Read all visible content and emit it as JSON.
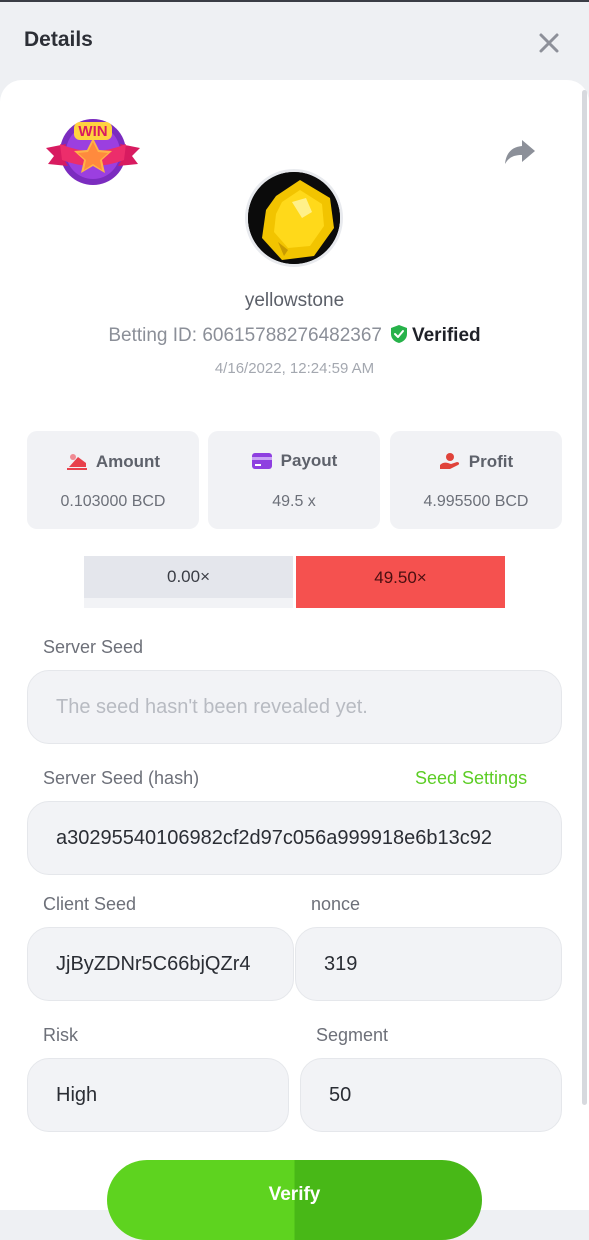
{
  "header": {
    "title": "Details"
  },
  "bet": {
    "username": "yellowstone",
    "betting_id_label": "Betting ID:",
    "betting_id": "60615788276482367",
    "verified_label": "Verified",
    "timestamp": "4/16/2022, 12:24:59 AM"
  },
  "logo": {
    "text": "WIN"
  },
  "stats": [
    {
      "label": "Amount",
      "value": "0.103000 BCD",
      "icon": "amount-icon",
      "color": "#e8414c"
    },
    {
      "label": "Payout",
      "value": "49.5 x",
      "icon": "card-icon",
      "color": "#8e3fe0"
    },
    {
      "label": "Profit",
      "value": "4.995500 BCD",
      "icon": "profit-icon",
      "color": "#e0433a"
    }
  ],
  "multipliers": [
    {
      "value": "0.00×",
      "color": "#e4e6ec"
    },
    {
      "value": "49.50×",
      "color": "#f5514f"
    }
  ],
  "server_seed": {
    "label": "Server Seed",
    "placeholder": "The seed hasn't been revealed yet."
  },
  "server_seed_hash": {
    "label": "Server Seed (hash)",
    "link": "Seed Settings",
    "value": "a30295540106982cf2d97c056a999918e6b13c92"
  },
  "client_seed": {
    "label": "Client Seed",
    "value": "JjByZDNr5C66bjQZr4"
  },
  "nonce": {
    "label": "nonce",
    "value": "319"
  },
  "risk": {
    "label": "Risk",
    "value": "High"
  },
  "segment": {
    "label": "Segment",
    "value": "50"
  },
  "verify": {
    "label": "Verify"
  },
  "colors": {
    "accent_green": "#5ed31f",
    "link_green": "#5ccd25",
    "danger_red": "#f5514f"
  }
}
